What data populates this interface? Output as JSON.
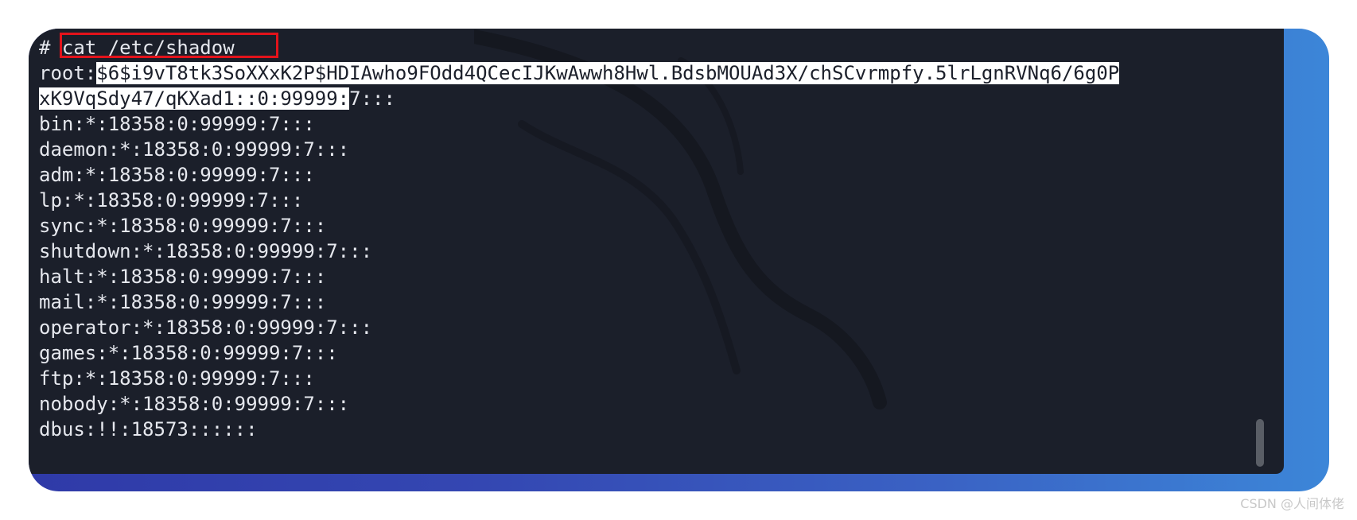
{
  "terminal": {
    "command_prompt": "# ",
    "command": "cat /etc/shadow",
    "root_line_1_user": "root:",
    "root_line_1_hash": "$6$i9vT8tk3SoXXxK2P$HDIAwho9FOdd4QCecIJKwAwwh8Hwl.BdsbMOUAd3X/chSCvrmpfy.5lrLgnRVNq6/6g0P",
    "root_line_2_sel": "xK9VqSdy47/qKXad1::0:99999:",
    "root_line_2_rest": "7:::",
    "lines": [
      "bin:*:18358:0:99999:7:::",
      "daemon:*:18358:0:99999:7:::",
      "adm:*:18358:0:99999:7:::",
      "lp:*:18358:0:99999:7:::",
      "sync:*:18358:0:99999:7:::",
      "shutdown:*:18358:0:99999:7:::",
      "halt:*:18358:0:99999:7:::",
      "mail:*:18358:0:99999:7:::",
      "operator:*:18358:0:99999:7:::",
      "games:*:18358:0:99999:7:::",
      "ftp:*:18358:0:99999:7:::",
      "nobody:*:18358:0:99999:7:::",
      "dbus:!!:18573::::::"
    ]
  },
  "watermark": "CSDN @人间体佬",
  "colors": {
    "terminal_bg": "#1b1f2a",
    "text": "#e6e8ee",
    "highlight_box": "#e3131b"
  }
}
